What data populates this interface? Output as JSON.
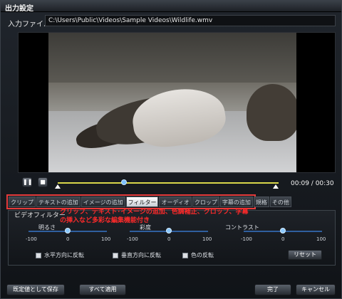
{
  "window": {
    "title": "出力設定"
  },
  "input": {
    "label": "入力ファイル：",
    "path": "C:\\Users\\Public\\Videos\\Sample Videos\\Wildlife.wmv"
  },
  "player": {
    "time": "00:09 / 00:30",
    "progress_fraction": 0.3
  },
  "tabs": [
    "クリップ",
    "テキストの追加",
    "イメージの追加",
    "フィルター",
    "オーディオ",
    "クロップ",
    "字幕の追加",
    "規格",
    "その他"
  ],
  "active_tab_index": 3,
  "effects": {
    "video_filter": "ビデオフィルター",
    "annotation": "クリップ、テキスト･イメージの追加、色調補正、クロップ、字幕の挿入など多彩な編集機能付き",
    "brightness": {
      "label": "明るさ",
      "min": "-100",
      "mid": "0",
      "max": "100"
    },
    "saturation": {
      "label": "彩度",
      "min": "-100",
      "mid": "0",
      "max": "100"
    },
    "contrast": {
      "label": "コントラスト",
      "min": "-100",
      "mid": "0",
      "max": "100"
    },
    "flip_horizontal": "水平方向に反転",
    "flip_vertical": "垂直方向に反転",
    "invert_color": "色の反転",
    "reset": "リセット"
  },
  "footer": {
    "save_default": "既定値として保存",
    "apply_all": "すべて適用",
    "done": "完了",
    "cancel": "キャンセル"
  }
}
